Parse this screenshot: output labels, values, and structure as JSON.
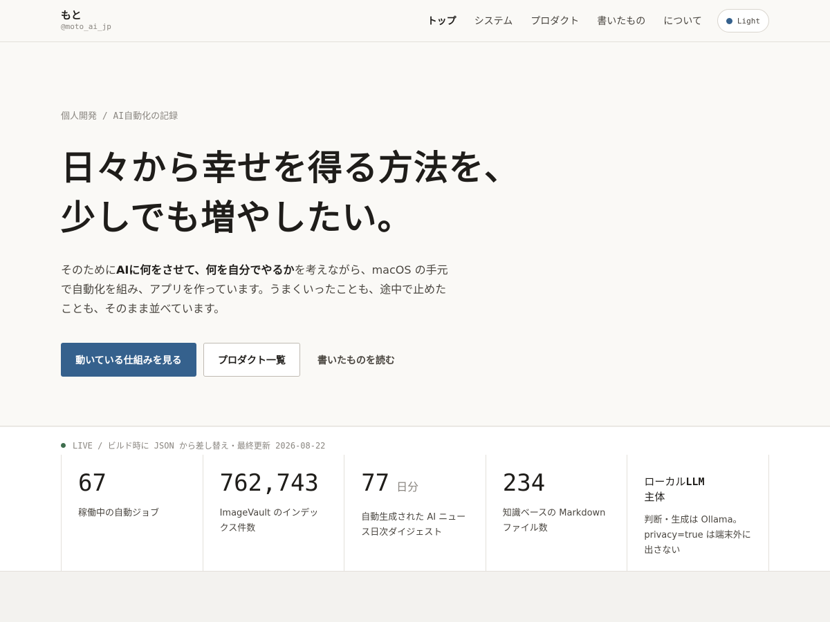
{
  "header": {
    "brand_name": "もと",
    "brand_handle": "@moto_ai_jp",
    "nav": [
      "トップ",
      "システム",
      "プロダクト",
      "書いたもの",
      "について"
    ],
    "theme_label": "Light"
  },
  "hero": {
    "kicker": "個人開発 / AI自動化の記録",
    "title_line1": "日々から幸せを得る方法を、",
    "title_line2": "少しでも増やしたい。",
    "desc_part1": "そのために",
    "desc_bold": "AIに何をさせて、何を自分でやるか",
    "desc_part2": "を考えながら、macOS の手元で自動化を組み、アプリを作っています。うまくいったことも、途中で止めたことも、そのまま並べています。",
    "cta_primary": "動いている仕組みを見る",
    "cta_secondary": "プロダクト一覧",
    "cta_link": "書いたものを読む"
  },
  "live": {
    "label": "LIVE / ビルド時に JSON から差し替え・最終更新 2026-08-22",
    "stats": [
      {
        "value": "67",
        "unit": "",
        "label": "稼働中の自動ジョブ"
      },
      {
        "value": "762,743",
        "unit": "",
        "label": "ImageVault のインデックス件数"
      },
      {
        "value": "77",
        "unit": "日分",
        "label": "自動生成された AI ニュース日次ダイジェスト"
      },
      {
        "value": "234",
        "unit": "",
        "label": "知識ベースの Markdown ファイル数"
      }
    ],
    "llm": {
      "heading_part1": "ローカル",
      "heading_bold": "LLM",
      "heading_part2": "主体",
      "note": "判断・生成は Ollama。privacy=true は端末外に出さない"
    }
  },
  "colors": {
    "accent": "#35618d",
    "live_dot": "#3f6e4e",
    "background": "#faf9f6"
  }
}
